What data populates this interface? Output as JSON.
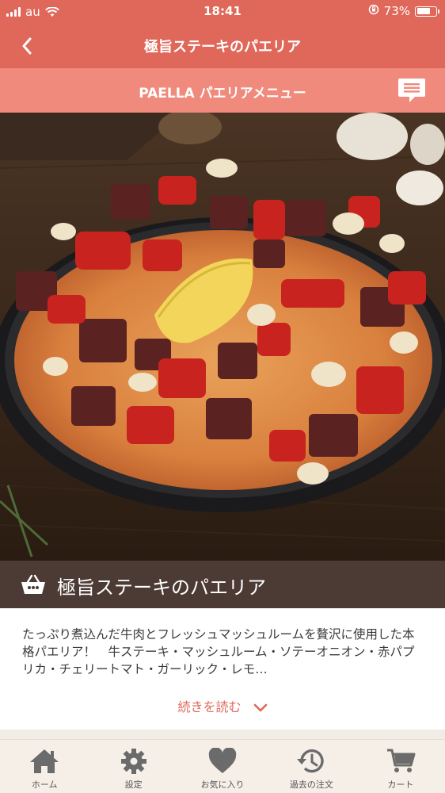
{
  "status_bar": {
    "carrier": "au",
    "time": "18:41",
    "battery": "73%",
    "battery_level": 0.73
  },
  "nav": {
    "title": "極旨ステーキのパエリア"
  },
  "sub_header": {
    "title": "PAELLA パエリアメニュー"
  },
  "product": {
    "name": "極旨ステーキのパエリア",
    "description": "たっぷり煮込んだ牛肉とフレッシュマッシュルームを贅沢に使用した本格パエリア！　牛ステーキ・マッシュルーム・ソテーオニオン・赤パプリカ・チェリートマト・ガーリック・レモ…",
    "read_more": "続きを読む"
  },
  "tabs": [
    {
      "label": "ホーム",
      "icon": "home-icon"
    },
    {
      "label": "設定",
      "icon": "gear-icon"
    },
    {
      "label": "お気に入り",
      "icon": "heart-icon"
    },
    {
      "label": "過去の注文",
      "icon": "history-icon"
    },
    {
      "label": "カート",
      "icon": "cart-icon"
    }
  ],
  "colors": {
    "header": "#e0685a",
    "sub_header": "#f08a7c",
    "product_bar": "#4c3a34",
    "tab_bar": "#f6efe8"
  }
}
